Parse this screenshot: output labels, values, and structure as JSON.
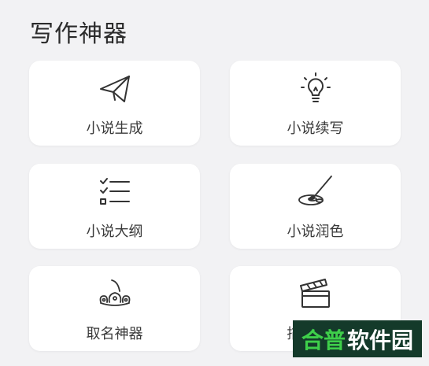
{
  "page": {
    "title": "写作神器"
  },
  "tools": [
    {
      "label": "小说生成",
      "icon": "paper-plane-icon"
    },
    {
      "label": "小说续写",
      "icon": "lightbulb-icon"
    },
    {
      "label": "小说大纲",
      "icon": "checklist-icon"
    },
    {
      "label": "小说润色",
      "icon": "paint-palette-icon"
    },
    {
      "label": "取名神器",
      "icon": "crown-icon"
    },
    {
      "label": "描写神器",
      "icon": "clapperboard-icon"
    }
  ],
  "watermark": {
    "part_a": "合普",
    "part_b": "软件园"
  },
  "colors": {
    "background": "#f2f2f4",
    "card": "#ffffff",
    "text": "#3a3a3a",
    "icon_stroke": "#333333"
  }
}
